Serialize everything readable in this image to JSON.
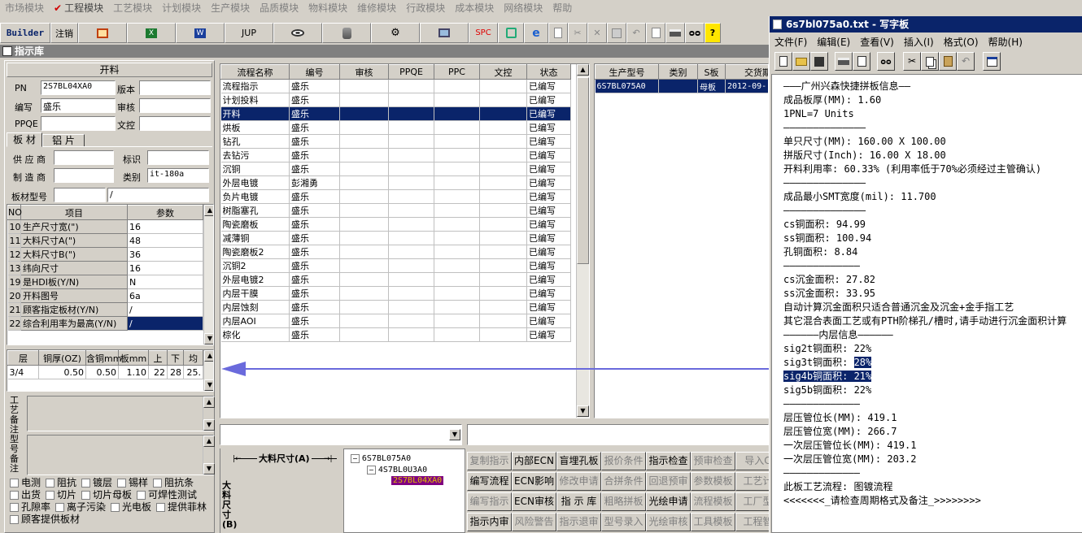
{
  "menubar": [
    "市场模块",
    "工程模块",
    "工艺模块",
    "计划模块",
    "生产模块",
    "品质模块",
    "物料模块",
    "维修模块",
    "行政模块",
    "成本模块",
    "网络模块",
    "帮助"
  ],
  "toolbar": {
    "builder": "Builder",
    "logout": "注销",
    "jup": "JUP",
    "spc": "SPC"
  },
  "panel_title": "指示库",
  "left": {
    "section": "开料",
    "pn_label": "PN",
    "pn_value": "2S7BL04XA0",
    "version_label": "版本",
    "version_value": "",
    "editor_label": "编写",
    "editor_value": "盛乐",
    "review_label": "审核",
    "review_value": "",
    "ppqe_label": "PPQE",
    "ppqe_value": "",
    "doc_label": "文控",
    "doc_value": "",
    "tabs": [
      "板 材",
      "铝 片"
    ],
    "supplier_label": "供 应 商",
    "mark_label": "标识",
    "maker_label": "制 造 商",
    "class_label": "类别",
    "class_value": "it-180a",
    "model_label": "板材型号",
    "model_value": "/",
    "param_headers": [
      "NO",
      "项目",
      "参数"
    ],
    "params": [
      {
        "no": "10",
        "item": "生产尺寸宽(\")",
        "val": "16"
      },
      {
        "no": "11",
        "item": "大料尺寸A(\")",
        "val": "48"
      },
      {
        "no": "12",
        "item": "大料尺寸B(\")",
        "val": "36"
      },
      {
        "no": "13",
        "item": "纬向尺寸",
        "val": "16"
      },
      {
        "no": "19",
        "item": "是HDI板(Y/N)",
        "val": "N"
      },
      {
        "no": "20",
        "item": "开料图号",
        "val": "6a"
      },
      {
        "no": "21",
        "item": "顾客指定板材(Y/N)",
        "val": "/"
      },
      {
        "no": "22",
        "item": "综合利用率为最高(Y/N)",
        "val": "/"
      }
    ],
    "layer_headers": [
      "层",
      "铜厚(OZ)",
      "含铜mm",
      "板mm",
      "上",
      "下",
      "均"
    ],
    "layer_row": [
      "3/4",
      "0.50",
      "0.50",
      "1.10",
      "22",
      "28",
      "25."
    ],
    "remark1": "工艺备注",
    "remark2": "型号备注",
    "checks": [
      [
        "电测",
        "阻抗",
        "镀层",
        "锡样",
        "阻抗条"
      ],
      [
        "出货",
        "切片",
        "切片母板",
        "可焊性测试"
      ],
      [
        "孔隙率",
        "离子污染",
        "光电板",
        "提供菲林"
      ],
      [
        "顾客提供板材"
      ]
    ]
  },
  "process": {
    "headers": [
      "流程名称",
      "编号",
      "审核",
      "PPQE",
      "PPC",
      "文控",
      "状态"
    ],
    "rows": [
      [
        "流程指示",
        "盛乐",
        "",
        "",
        "",
        "",
        "已编写"
      ],
      [
        "计划投料",
        "盛乐",
        "",
        "",
        "",
        "",
        "已编写"
      ],
      [
        "开料",
        "盛乐",
        "",
        "",
        "",
        "",
        "已编写"
      ],
      [
        "烘板",
        "盛乐",
        "",
        "",
        "",
        "",
        "已编写"
      ],
      [
        "钻孔",
        "盛乐",
        "",
        "",
        "",
        "",
        "已编写"
      ],
      [
        "去钻污",
        "盛乐",
        "",
        "",
        "",
        "",
        "已编写"
      ],
      [
        "沉铜",
        "盛乐",
        "",
        "",
        "",
        "",
        "已编写"
      ],
      [
        "外层电镀",
        "彭湘勇",
        "",
        "",
        "",
        "",
        "已编写"
      ],
      [
        "负片电镀",
        "盛乐",
        "",
        "",
        "",
        "",
        "已编写"
      ],
      [
        "树脂塞孔",
        "盛乐",
        "",
        "",
        "",
        "",
        "已编写"
      ],
      [
        "陶瓷磨板",
        "盛乐",
        "",
        "",
        "",
        "",
        "已编写"
      ],
      [
        "减薄铜",
        "盛乐",
        "",
        "",
        "",
        "",
        "已编写"
      ],
      [
        "陶瓷磨板2",
        "盛乐",
        "",
        "",
        "",
        "",
        "已编写"
      ],
      [
        "沉铜2",
        "盛乐",
        "",
        "",
        "",
        "",
        "已编写"
      ],
      [
        "外层电镀2",
        "盛乐",
        "",
        "",
        "",
        "",
        "已编写"
      ],
      [
        "内层干膜",
        "盛乐",
        "",
        "",
        "",
        "",
        "已编写"
      ],
      [
        "内层蚀刻",
        "盛乐",
        "",
        "",
        "",
        "",
        "已编写"
      ],
      [
        "内层AOI",
        "盛乐",
        "",
        "",
        "",
        "",
        "已编写"
      ],
      [
        "棕化",
        "盛乐",
        "",
        "",
        "",
        "",
        "已编写"
      ]
    ]
  },
  "product": {
    "headers": [
      "生产型号",
      "类别",
      "S板",
      "交货期"
    ],
    "row": [
      "6S7BL075A0",
      "",
      "母板",
      "2012-09-"
    ]
  },
  "dim": {
    "label_a": "大料尺寸(A)",
    "label_b": "大料尺寸(B)"
  },
  "tree": [
    "6S7BL075A0",
    "4S7BL0U3A0",
    "2S7BL04XA0"
  ],
  "buttons": [
    [
      "复制指示",
      "内部ECN",
      "盲埋孔板",
      "报价条件",
      "指示检查",
      "预审检查",
      "导入C"
    ],
    [
      "编写流程",
      "ECN影响",
      "修改申请",
      "合拼条件",
      "回退预审",
      "参数模板",
      "工艺计"
    ],
    [
      "编写指示",
      "ECN审核",
      "指 示 库",
      "粗略拼板",
      "光绘申请",
      "流程模板",
      "工厂型"
    ],
    [
      "指示内审",
      "风险警告",
      "指示退审",
      "型号录入",
      "光绘审核",
      "工具模板",
      "工程智"
    ]
  ],
  "wordpad": {
    "title": "6s7bl075a0.txt - 写字板",
    "menu": [
      "文件(F)",
      "编辑(E)",
      "查看(V)",
      "插入(I)",
      "格式(O)",
      "帮助(H)"
    ],
    "lines": [
      "———广州兴森快捷拼板信息——",
      "成品板厚(MM): 1.60",
      "1PNL=7 Units",
      "——————————————",
      "单只尺寸(MM): 160.00 X 100.00",
      "拼版尺寸(Inch): 16.00 X 18.00",
      "开料利用率: 60.33% (利用率低于70%必须经过主管确认)",
      "——————————————",
      "成品最小SMT宽度(mil): 11.700",
      "——————————————",
      "cs铜面积: 94.99",
      "ss铜面积: 100.94",
      "孔铜面积: 8.84",
      "—————————————",
      "cs沉金面积: 27.82",
      "ss沉金面积: 33.95",
      "自动计算沉金面积只适合普通沉金及沉金+金手指工艺",
      "其它混合表面工艺或有PTH阶梯孔/槽时,请手动进行沉金面积计算",
      "——————内层信息——————",
      "sig2t铜面积: 22%",
      "sig3t铜面积: 28%",
      "sig4b铜面积: 21%",
      "sig5b铜面积: 22%",
      "—————————————",
      "层压管位长(MM): 419.1",
      "层压管位宽(MM): 266.7",
      "一次层压管位长(MM): 419.1",
      "一次层压管位宽(MM): 203.2",
      "—————————————",
      "此板工艺流程: 图镀流程",
      "<<<<<<<_请检查周期格式及备注_>>>>>>>>"
    ]
  }
}
